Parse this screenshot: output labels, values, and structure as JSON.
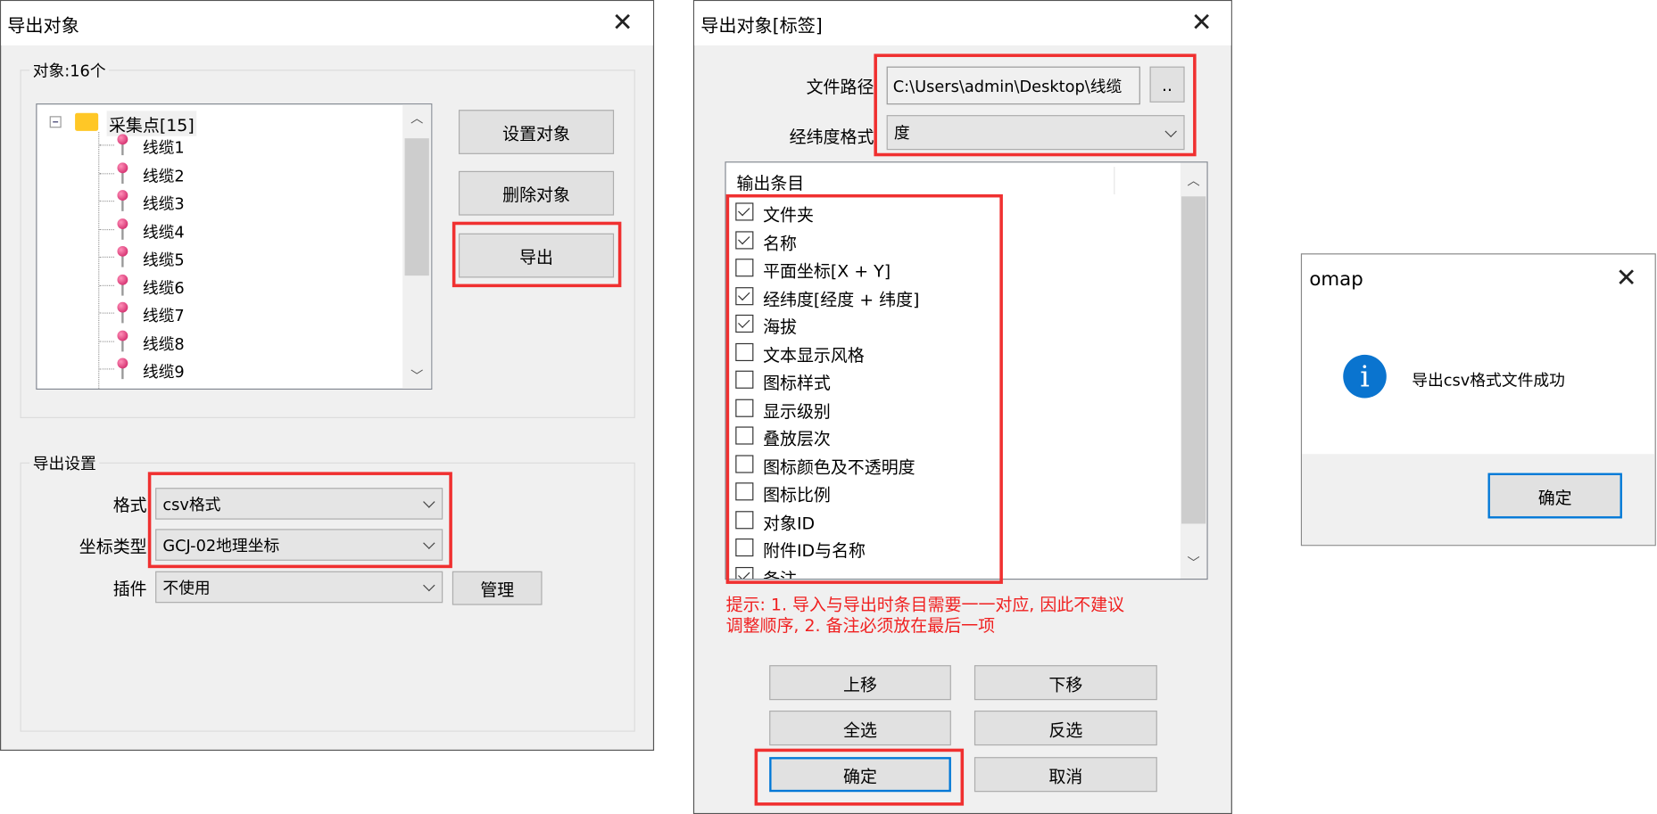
{
  "export_dialog": {
    "title": "导出对象",
    "objects_group": "对象:16个",
    "tree": {
      "root": "采集点[15]",
      "items": [
        "线缆1",
        "线缆2",
        "线缆3",
        "线缆4",
        "线缆5",
        "线缆6",
        "线缆7",
        "线缆8",
        "线缆9"
      ]
    },
    "buttons": {
      "set": "设置对象",
      "delete": "删除对象",
      "export": "导出"
    },
    "settings_group": "导出设置",
    "format_label": "格式",
    "format_value": "csv格式",
    "coord_label": "坐标类型",
    "coord_value": "GCJ-02地理坐标",
    "plugin_label": "插件",
    "plugin_value": "不使用",
    "manage": "管理"
  },
  "tag_dialog": {
    "title": "导出对象[标签]",
    "path_label": "文件路径",
    "path_value": "C:\\Users\\admin\\Desktop\\线缆",
    "browse": "..",
    "latlon_label": "经纬度格式",
    "latlon_value": "度",
    "list_header": "输出条目",
    "items": [
      {
        "label": "文件夹",
        "checked": true
      },
      {
        "label": "名称",
        "checked": true
      },
      {
        "label": "平面坐标[X + Y]",
        "checked": false
      },
      {
        "label": "经纬度[经度 + 纬度]",
        "checked": true
      },
      {
        "label": "海拔",
        "checked": true
      },
      {
        "label": "文本显示风格",
        "checked": false
      },
      {
        "label": "图标样式",
        "checked": false
      },
      {
        "label": "显示级别",
        "checked": false
      },
      {
        "label": "叠放层次",
        "checked": false
      },
      {
        "label": "图标颜色及不透明度",
        "checked": false
      },
      {
        "label": "图标比例",
        "checked": false
      },
      {
        "label": "对象ID",
        "checked": false
      },
      {
        "label": "附件ID与名称",
        "checked": false
      },
      {
        "label": "备注",
        "checked": true
      }
    ],
    "hint_line1": "提示: 1. 导入与导出时条目需要一一对应, 因此不建议",
    "hint_line2": "调整顺序, 2. 备注必须放在最后一项",
    "buttons": {
      "up": "上移",
      "down": "下移",
      "all": "全选",
      "invert": "反选",
      "ok": "确定",
      "cancel": "取消"
    }
  },
  "message_box": {
    "title": "omap",
    "icon": "info-icon",
    "message": "导出csv格式文件成功",
    "ok": "确定"
  },
  "colors": {
    "highlight": "#f03030",
    "info": "#0a74cf",
    "default_button_border": "#0078d7",
    "hint_text": "#f02020"
  }
}
